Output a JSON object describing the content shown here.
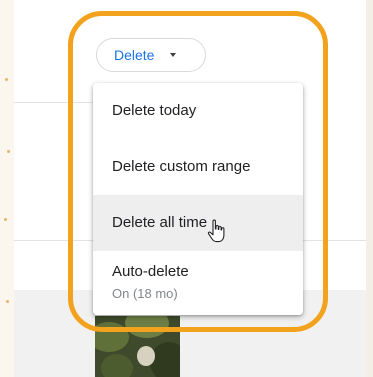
{
  "delete_chip": {
    "label": "Delete",
    "caret_icon": "arrow-drop-down-icon"
  },
  "menu": {
    "items": [
      {
        "label": "Delete today"
      },
      {
        "label": "Delete custom range"
      },
      {
        "label": "Delete all time",
        "hovered": true
      },
      {
        "label": "Auto-delete",
        "sublabel": "On (18 mo)"
      }
    ]
  },
  "colors": {
    "accent_blue": "#1a73e8",
    "highlight_ring": "#f2a21d",
    "menu_text": "#202124",
    "menu_subtext": "#80868b",
    "hover_bg": "#eeeeee"
  }
}
